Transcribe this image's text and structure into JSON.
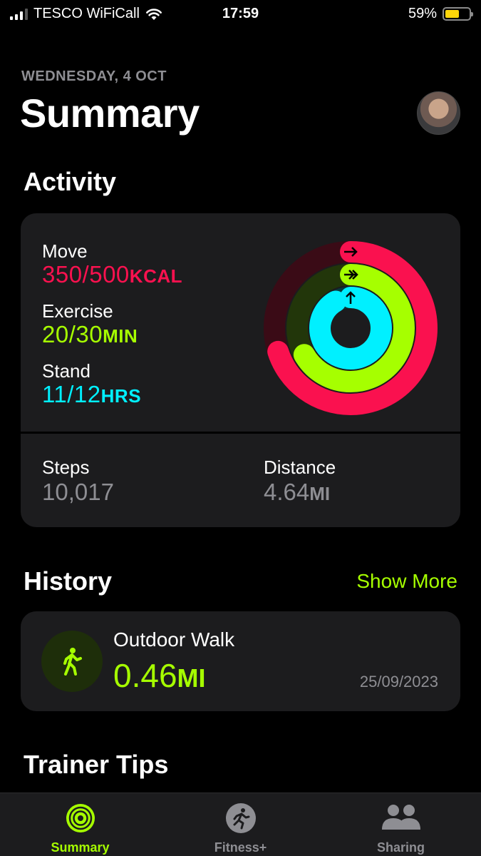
{
  "status": {
    "carrier": "TESCO WiFiCall",
    "time": "17:59",
    "battery_text": "59%",
    "battery_level": 0.59,
    "battery_color": "#ffd60a"
  },
  "header": {
    "date": "WEDNESDAY, 4 OCT",
    "title": "Summary"
  },
  "activity": {
    "section_title": "Activity",
    "move": {
      "label": "Move",
      "value": "350/500",
      "unit": "KCAL",
      "progress": 0.7,
      "color": "#fa114f"
    },
    "exercise": {
      "label": "Exercise",
      "value": "20/30",
      "unit": "MIN",
      "progress": 0.667,
      "color": "#a6ff00"
    },
    "stand": {
      "label": "Stand",
      "value": "11/12",
      "unit": "HRS",
      "progress": 0.917,
      "color": "#00f0ff"
    },
    "steps": {
      "label": "Steps",
      "value": "10,017"
    },
    "distance": {
      "label": "Distance",
      "value": "4.64",
      "unit": "MI"
    }
  },
  "history": {
    "section_title": "History",
    "show_more": "Show More",
    "workout": {
      "icon": "walking-figure-icon",
      "title": "Outdoor Walk",
      "value": "0.46",
      "unit": "MI",
      "date": "25/09/2023"
    }
  },
  "trainer_tips": {
    "section_title": "Trainer Tips"
  },
  "tabs": [
    {
      "label": "Summary",
      "icon": "activity-rings-icon",
      "active": true
    },
    {
      "label": "Fitness+",
      "icon": "running-figure-icon",
      "active": false
    },
    {
      "label": "Sharing",
      "icon": "people-icon",
      "active": false
    }
  ]
}
